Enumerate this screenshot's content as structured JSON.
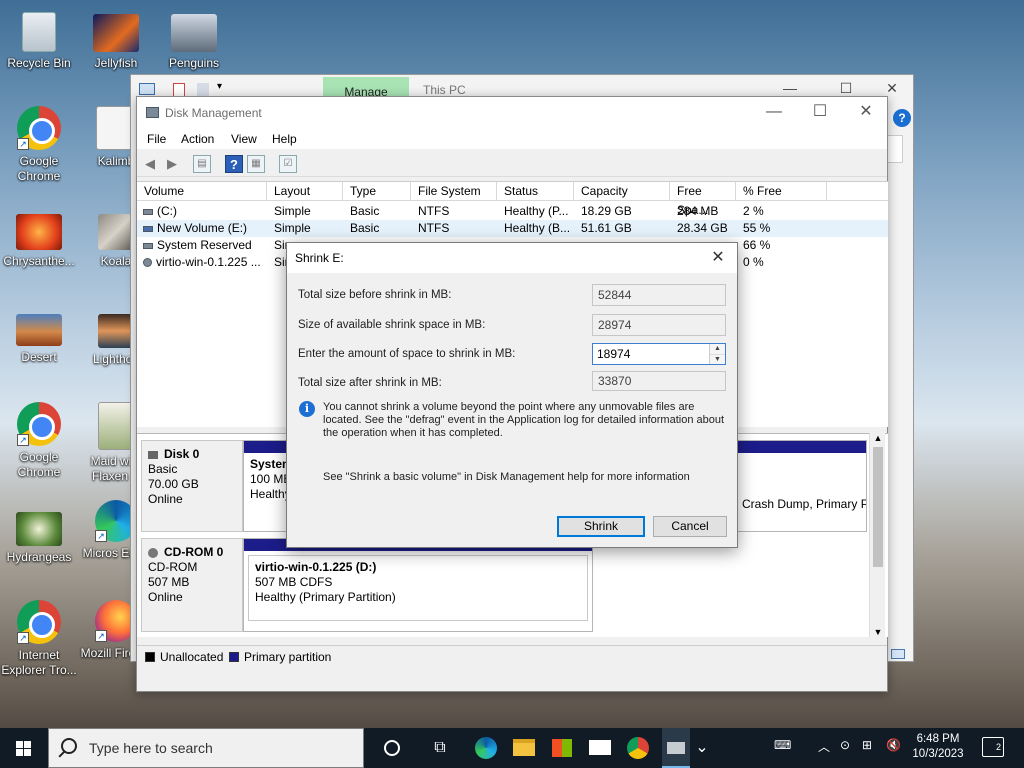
{
  "desktop": {
    "icons": [
      {
        "label": "Recycle Bin"
      },
      {
        "label": "Jellyfish"
      },
      {
        "label": "Penguins"
      },
      {
        "label": "Google Chrome"
      },
      {
        "label": "Kalimb"
      },
      {
        "label": "Chrysanthe..."
      },
      {
        "label": "Koala"
      },
      {
        "label": "Desert"
      },
      {
        "label": "Lighthou"
      },
      {
        "label": "Google Chrome"
      },
      {
        "label": "Maid with Flaxen H"
      },
      {
        "label": "Hydrangeas"
      },
      {
        "label": "Micros Edge"
      },
      {
        "label": "Internet Explorer Tro..."
      },
      {
        "label": "Mozill Firefox"
      }
    ]
  },
  "explorer": {
    "ribbon_tab": "Manage",
    "title": "This PC"
  },
  "disk_management": {
    "title": "Disk Management",
    "menu": [
      "File",
      "Action",
      "View",
      "Help"
    ],
    "columns": [
      "Volume",
      "Layout",
      "Type",
      "File System",
      "Status",
      "Capacity",
      "Free Spa...",
      "% Free"
    ],
    "rows": [
      {
        "volume": "(C:)",
        "layout": "Simple",
        "type": "Basic",
        "fs": "NTFS",
        "status": "Healthy (P...",
        "capacity": "18.29 GB",
        "free": "284 MB",
        "pct": "2 %"
      },
      {
        "volume": "New Volume (E:)",
        "layout": "Simple",
        "type": "Basic",
        "fs": "NTFS",
        "status": "Healthy (B...",
        "capacity": "51.61 GB",
        "free": "28.34 GB",
        "pct": "55 %"
      },
      {
        "volume": "System Reserved",
        "layout": "Simp",
        "type": "",
        "fs": "",
        "status": "",
        "capacity": "",
        "free": "",
        "pct": "66 %"
      },
      {
        "volume": "virtio-win-0.1.225 ...",
        "layout": "Sir",
        "type": "",
        "fs": "",
        "status": "",
        "capacity": "",
        "free": "",
        "pct": "0 %"
      }
    ],
    "disk0": {
      "name": "Disk 0",
      "type": "Basic",
      "size": "70.00 GB",
      "state": "Online"
    },
    "disk0_part1": {
      "name": "System",
      "line2": "100 MB",
      "line3": "Healthy"
    },
    "disk0_part3_status": "Crash Dump, Primary P",
    "cdrom": {
      "name": "CD-ROM 0",
      "type": "CD-ROM",
      "size": "507 MB",
      "state": "Online"
    },
    "cdrom_part": {
      "name": "virtio-win-0.1.225  (D:)",
      "line2": "507 MB CDFS",
      "line3": "Healthy (Primary Partition)"
    },
    "legend": {
      "unallocated": "Unallocated",
      "primary": "Primary partition"
    }
  },
  "shrink_dialog": {
    "title": "Shrink E:",
    "total_before_label": "Total size before shrink in MB:",
    "total_before_value": "52844",
    "available_label": "Size of available shrink space in MB:",
    "available_value": "28974",
    "amount_label": "Enter the amount of space to shrink in MB:",
    "amount_value": "18974",
    "total_after_label": "Total size after shrink in MB:",
    "total_after_value": "33870",
    "info_text": "You cannot shrink a volume beyond the point where any unmovable files are located. See the \"defrag\" event in the Application log for detailed information about the operation when it has completed.",
    "help_text": "See \"Shrink a basic volume\" in Disk Management help for more information",
    "shrink_label": "Shrink",
    "cancel_label": "Cancel"
  },
  "taskbar": {
    "search_placeholder": "Type here to search",
    "time": "6:48 PM",
    "date": "10/3/2023",
    "notification_count": "2"
  }
}
